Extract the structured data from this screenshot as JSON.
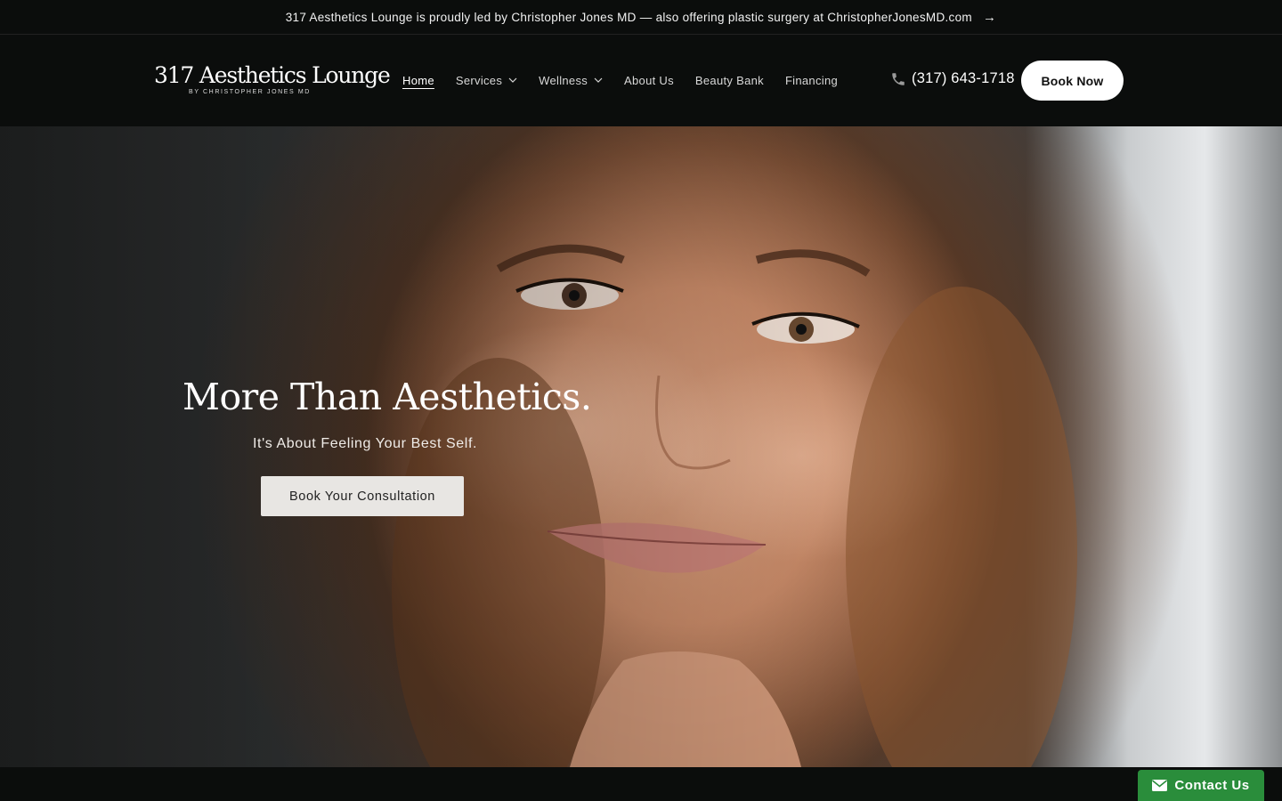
{
  "announcement": {
    "text": "317 Aesthetics Lounge is proudly led by Christopher Jones MD — also offering plastic surgery at ChristopherJonesMD.com",
    "arrow": "→"
  },
  "logo": {
    "main": "317 Aesthetics Lounge",
    "sub": "BY CHRISTOPHER JONES MD"
  },
  "nav": {
    "items": [
      {
        "label": "Home"
      },
      {
        "label": "Services"
      },
      {
        "label": "Wellness"
      },
      {
        "label": "About Us"
      },
      {
        "label": "Beauty Bank"
      },
      {
        "label": "Financing"
      }
    ]
  },
  "header": {
    "phone": "(317) 643-1718",
    "book_label": "Book Now"
  },
  "hero": {
    "title": "More Than Aesthetics.",
    "subtitle": "It's About Feeling Your Best Self.",
    "cta_label": "Book Your Consultation"
  },
  "contact_widget": {
    "label": "Contact Us",
    "color": "#2a8d3b"
  },
  "icons": {
    "phone": "phone-icon",
    "chevron": "chevron-down-icon",
    "arrow": "arrow-right-icon",
    "mail": "envelope-icon"
  }
}
